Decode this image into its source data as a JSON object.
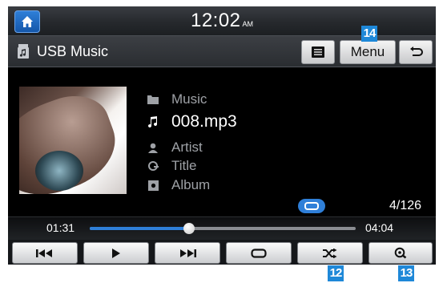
{
  "status_bar": {
    "time": "12:02",
    "ampm": "AM"
  },
  "header": {
    "source_title": "USB Music",
    "menu_label": "Menu"
  },
  "track": {
    "folder": "Music",
    "file": "008.mp3",
    "artist": "Artist",
    "title": "Title",
    "album": "Album",
    "track_count": "4/126"
  },
  "progress": {
    "elapsed": "01:31",
    "total": "04:04",
    "fraction": 0.373
  },
  "controls": [
    "previous-track",
    "play",
    "next-track",
    "repeat",
    "shuffle",
    "scan"
  ],
  "callouts": {
    "menu": "14",
    "shuffle": "12",
    "scan": "13"
  },
  "colors": {
    "accent": "#2f7fd8",
    "callout": "#1e88d8",
    "background": "#000000"
  }
}
